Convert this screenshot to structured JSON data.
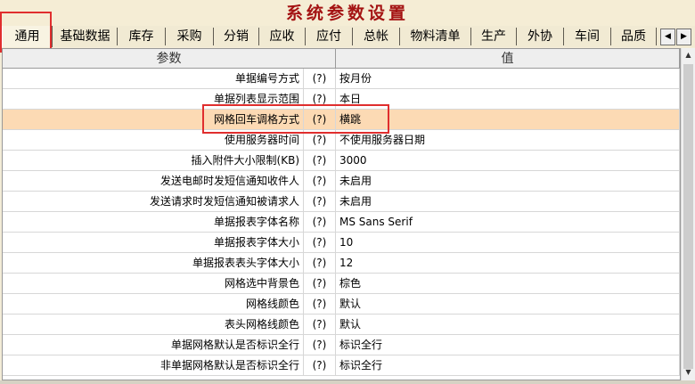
{
  "window": {
    "title": "系统参数设置"
  },
  "tabs": [
    {
      "label": "通用",
      "active": true
    },
    {
      "label": "基础数据"
    },
    {
      "label": "库存"
    },
    {
      "label": "采购"
    },
    {
      "label": "分销"
    },
    {
      "label": "应收"
    },
    {
      "label": "应付"
    },
    {
      "label": "总帐"
    },
    {
      "label": "物料清单"
    },
    {
      "label": "生产"
    },
    {
      "label": "外协"
    },
    {
      "label": "车间"
    },
    {
      "label": "品质"
    }
  ],
  "tab_scroll": {
    "left": "◀",
    "right": "▶"
  },
  "grid": {
    "col_param": "参数",
    "col_value": "值",
    "rows": [
      {
        "name": "单据编号方式",
        "help": "(?)",
        "value": "按月份"
      },
      {
        "name": "单据列表显示范围",
        "help": "(?)",
        "value": "本日"
      },
      {
        "name": "网格回车调格方式",
        "help": "(?)",
        "value": "横跳",
        "selected": true
      },
      {
        "name": "使用服务器时间",
        "help": "(?)",
        "value": "不使用服务器日期"
      },
      {
        "name": "插入附件大小限制(KB)",
        "help": "(?)",
        "value": "3000"
      },
      {
        "name": "发送电邮时发短信通知收件人",
        "help": "(?)",
        "value": "未启用"
      },
      {
        "name": "发送请求时发短信通知被请求人",
        "help": "(?)",
        "value": "未启用"
      },
      {
        "name": "单据报表字体名称",
        "help": "(?)",
        "value": "MS Sans Serif"
      },
      {
        "name": "单据报表字体大小",
        "help": "(?)",
        "value": "10"
      },
      {
        "name": "单据报表表头字体大小",
        "help": "(?)",
        "value": "12"
      },
      {
        "name": "网格选中背景色",
        "help": "(?)",
        "value": "棕色"
      },
      {
        "name": "网格线颜色",
        "help": "(?)",
        "value": "默认"
      },
      {
        "name": "表头网格线颜色",
        "help": "(?)",
        "value": "默认"
      },
      {
        "name": "单据网格默认是否标识全行",
        "help": "(?)",
        "value": "标识全行"
      },
      {
        "name": "非单据网格默认是否标识全行",
        "help": "(?)",
        "value": "标识全行"
      }
    ]
  },
  "scrollbar": {
    "up": "▲",
    "down": "▼"
  },
  "colors": {
    "title": "#a41313",
    "selected_row": "#fcdab4",
    "highlight_box": "#e02e2e"
  }
}
